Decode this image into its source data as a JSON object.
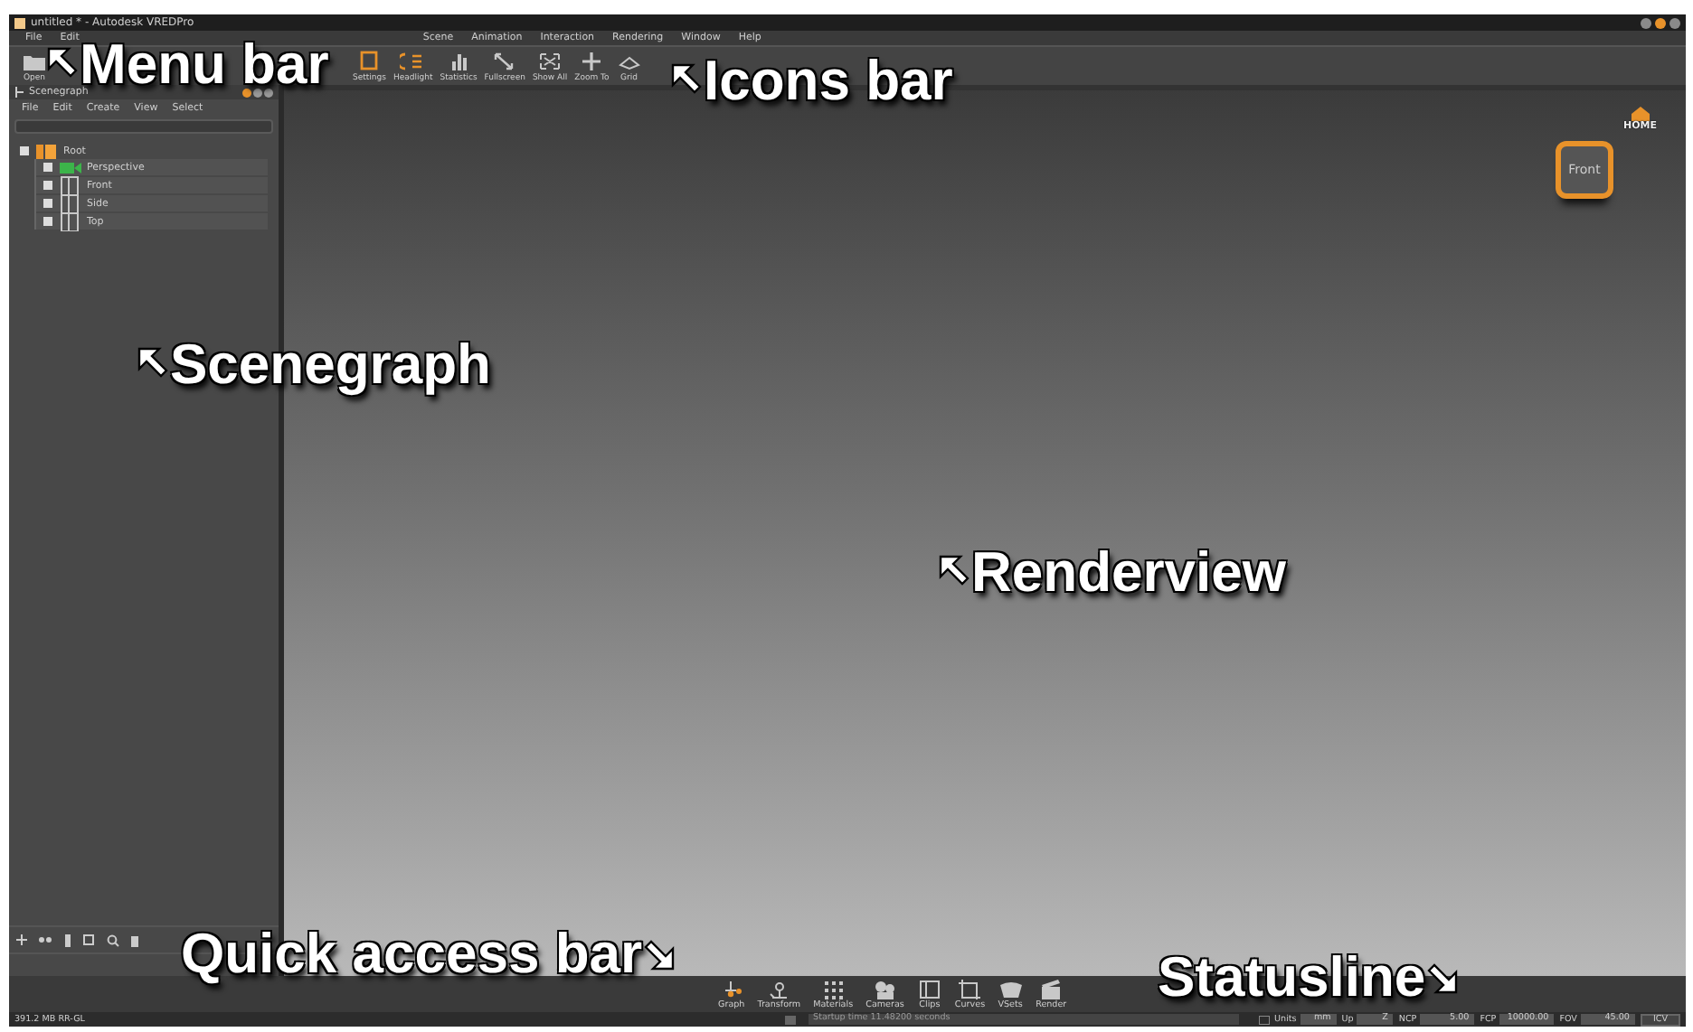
{
  "window": {
    "title": "untitled * - Autodesk VREDPro"
  },
  "menu_bar": [
    "File",
    "Edit",
    "Scene",
    "Animation",
    "Interaction",
    "Rendering",
    "Window",
    "Help"
  ],
  "icons_bar": [
    {
      "label": "Open",
      "kind": "folder"
    },
    {
      "label": "Settings",
      "kind": "settings"
    },
    {
      "label": "Headlight",
      "kind": "headlight"
    },
    {
      "label": "Statistics",
      "kind": "statistics"
    },
    {
      "label": "Fullscreen",
      "kind": "fullscreen"
    },
    {
      "label": "Show All",
      "kind": "showall"
    },
    {
      "label": "Zoom To",
      "kind": "zoomto"
    },
    {
      "label": "Grid",
      "kind": "grid"
    }
  ],
  "scenegraph": {
    "title": "Scenegraph",
    "menu": [
      "File",
      "Edit",
      "Create",
      "View",
      "Select"
    ],
    "tree": [
      {
        "label": "Root",
        "kind": "group",
        "children": [
          {
            "label": "Perspective",
            "kind": "camera"
          },
          {
            "label": "Front",
            "kind": "view"
          },
          {
            "label": "Side",
            "kind": "view"
          },
          {
            "label": "Top",
            "kind": "view"
          }
        ]
      }
    ]
  },
  "navigation_cube": {
    "face": "Front",
    "home": "HOME"
  },
  "quick_access": [
    {
      "label": "Graph",
      "kind": "graph",
      "selected": true
    },
    {
      "label": "Transform",
      "kind": "transform",
      "selected": false
    },
    {
      "label": "Materials",
      "kind": "materials",
      "selected": false
    },
    {
      "label": "Cameras",
      "kind": "cameras",
      "selected": false
    },
    {
      "label": "Clips",
      "kind": "clips",
      "selected": false
    },
    {
      "label": "Curves",
      "kind": "curves",
      "selected": false
    },
    {
      "label": "VSets",
      "kind": "vsets",
      "selected": false
    },
    {
      "label": "Render",
      "kind": "render",
      "selected": false
    }
  ],
  "statusline": {
    "memory": "391.2 MB RR-GL",
    "message": "Startup time 11.48200 seconds",
    "fields": [
      {
        "label": "Units",
        "value": "mm"
      },
      {
        "label": "Up",
        "value": "Z"
      },
      {
        "label": "NCP",
        "value": "5.00"
      },
      {
        "label": "FCP",
        "value": "10000.00"
      },
      {
        "label": "FOV",
        "value": "45.00"
      }
    ],
    "button": "ICV"
  },
  "annotations": [
    {
      "text": "Menu bar",
      "kind": "up-left"
    },
    {
      "text": "Icons bar",
      "kind": "up-left"
    },
    {
      "text": "Scenegraph",
      "kind": "up-left"
    },
    {
      "text": "Renderview",
      "kind": "up-left"
    },
    {
      "text": "Quick access bar",
      "kind": "down-right"
    },
    {
      "text": "Statusline",
      "kind": "down-right"
    }
  ]
}
